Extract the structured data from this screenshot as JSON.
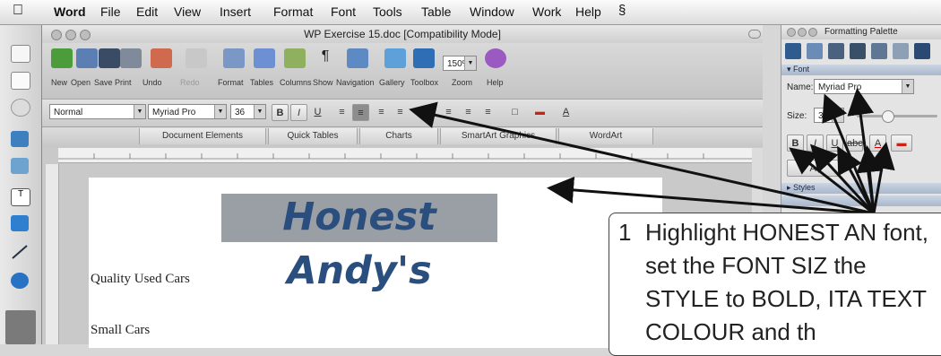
{
  "menubar": {
    "items": [
      "Word",
      "File",
      "Edit",
      "View",
      "Insert",
      "Format",
      "Font",
      "Tools",
      "Table",
      "Window",
      "Work",
      "Help"
    ]
  },
  "window": {
    "title": "WP Exercise 15.doc [Compatibility Mode]"
  },
  "toolbar": {
    "labels": [
      "New",
      "Open",
      "Save",
      "Print",
      "Undo",
      "Redo",
      "Format",
      "Tables",
      "Columns",
      "Show",
      "Navigation",
      "Gallery",
      "Toolbox",
      "Zoom",
      "Help"
    ],
    "zoom_value": "150%"
  },
  "format_bar": {
    "style_value": "Normal",
    "font_value": "Myriad Pro",
    "size_value": "36"
  },
  "ribbon": {
    "tabs": [
      "Document Elements",
      "Quick Tables",
      "Charts",
      "SmartArt Graphics",
      "WordArt"
    ]
  },
  "document": {
    "heading": "Honest Andy's",
    "line1": "Quality Used Cars",
    "line2": "Small Cars"
  },
  "palette": {
    "title": "Formatting Palette",
    "font_section": "Font",
    "name_label": "Name:",
    "name_value": "Myriad Pro",
    "size_label": "Size:",
    "size_value": "36",
    "styles_section": "Styles"
  },
  "callout": {
    "number": "1",
    "text": "Highlight HONEST AN font, set the FONT SIZ the STYLE to BOLD, ITA TEXT COLOUR and th"
  },
  "colors": {
    "heading_text": "#2a4f7e",
    "heading_highlight": "#9a9fa6",
    "palette_section": "#a9b7cc"
  }
}
